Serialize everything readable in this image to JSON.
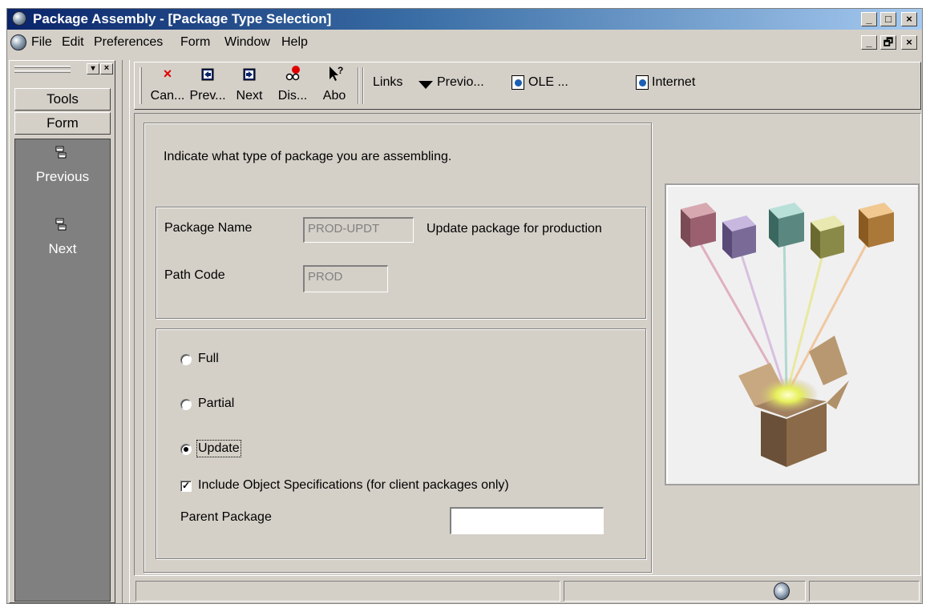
{
  "window": {
    "title": "Package Assembly - [Package Type Selection]",
    "caption_buttons": [
      "_",
      "□",
      "×"
    ],
    "mdi_buttons": [
      "_",
      "🗗",
      "×"
    ]
  },
  "menubar": {
    "items": [
      "File",
      "Edit",
      "Preferences",
      "Form",
      "Window",
      "Help"
    ]
  },
  "left_pane": {
    "tools_label": "Tools",
    "form_label": "Form",
    "items": [
      {
        "label": "Previous",
        "icon": "previous-form-icon"
      },
      {
        "label": "Next",
        "icon": "next-form-icon"
      }
    ]
  },
  "toolbar": {
    "cancel": "Can...",
    "prev": "Prev...",
    "next": "Next",
    "display": "Dis...",
    "about": "Abo",
    "links": "Links",
    "previous_link": "Previo...",
    "ole": "OLE ...",
    "internet": "Internet"
  },
  "form": {
    "instruction": "Indicate what type of package you are assembling.",
    "package_name_label": "Package Name",
    "package_name_value": "PROD-UPDT",
    "package_description": "Update package for production",
    "path_code_label": "Path Code",
    "path_code_value": "PROD",
    "options": [
      {
        "label": "Full",
        "checked": false
      },
      {
        "label": "Partial",
        "checked": false
      },
      {
        "label": "Update",
        "checked": true
      }
    ],
    "include_specs_label": "Include Object Specifications (for client packages only)",
    "include_specs_checked": true,
    "parent_package_label": "Parent Package",
    "parent_package_value": ""
  },
  "colors": {
    "face": "#d4d0c8",
    "title_start": "#0a246a",
    "title_end": "#a6caf0",
    "nav_strip": "#808080"
  }
}
